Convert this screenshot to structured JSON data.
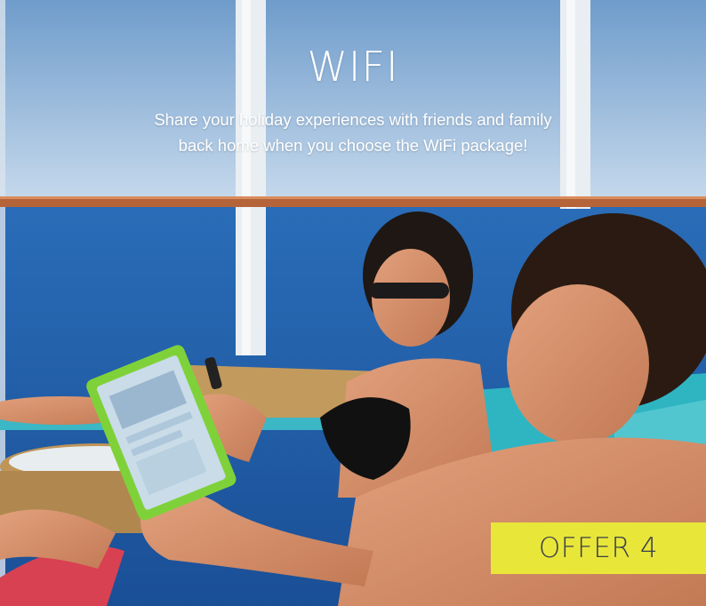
{
  "promo": {
    "heading": "WIFI",
    "tagline_line1": "Share your holiday experiences with friends and family",
    "tagline_line2": "back home when you choose the WiFi package!",
    "badge_label": "OFFER 4",
    "badge_color": "#e9e63a"
  },
  "photo": {
    "subject": "couple on sun loungers on a cruise ship deck using a tablet and a phone, ocean behind"
  }
}
